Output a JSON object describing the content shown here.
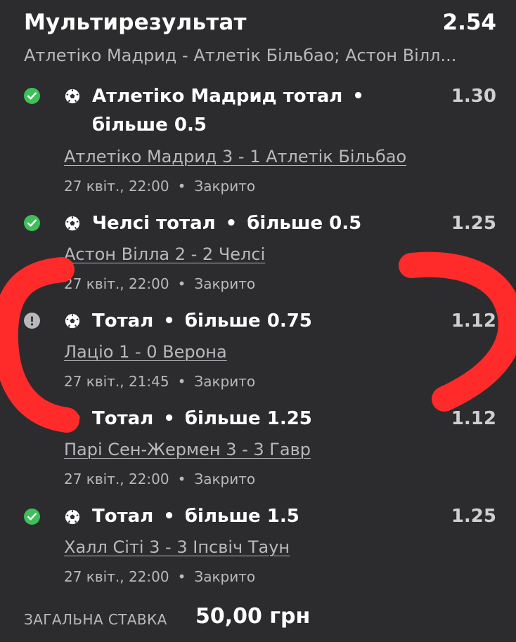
{
  "header": {
    "title": "Мультирезультат",
    "total_odds": "2.54",
    "events_summary": "Атлетіко Мадрид - Атлетік Більбао; Астон Вілл..."
  },
  "selections": [
    {
      "status": "won",
      "market_line1": "Атлетіко Мадрид тотал",
      "market_line2": "більше 0.5",
      "odds": "1.30",
      "match": "Атлетіко Мадрид 3 - 1 Атлетік Більбао",
      "date": "27 квіт., 22:00",
      "state": "Закрито"
    },
    {
      "status": "won",
      "market_line1": "Челсі тотал",
      "market_line2": "більше 0.5",
      "odds": "1.25",
      "match": "Астон Вілла 2 - 2 Челсі",
      "date": "27 квіт., 22:00",
      "state": "Закрито"
    },
    {
      "status": "alert",
      "market_line1": "Тотал",
      "market_line2": "більше 0.75",
      "odds": "1.12",
      "match": "Лаціо 1 - 0 Верона",
      "date": "27 квіт., 21:45",
      "state": "Закрито"
    },
    {
      "status": "hidden",
      "market_line1": "Тотал",
      "market_line2": "більше 1.25",
      "odds": "1.12",
      "match": "Парі Сен-Жермен 3 - 3 Гавр",
      "date": "27 квіт., 22:00",
      "state": "Закрито"
    },
    {
      "status": "won",
      "market_line1": "Тотал",
      "market_line2": "більше 1.5",
      "odds": "1.25",
      "match": "Халл Сіті 3 - 3 Іпсвіч Таун",
      "date": "27 квіт., 22:00",
      "state": "Закрито"
    }
  ],
  "footer": {
    "stake_label": "ЗАГАЛЬНА СТАВКА",
    "stake_value": "50,00 грн"
  },
  "colors": {
    "background": "#2c2c2e",
    "won": "#3fbf5a",
    "alert": "#b9b9bd",
    "annotation": "#ff2a2a"
  },
  "icons": {
    "won": "check-circle-icon",
    "alert": "exclamation-circle-icon",
    "sport": "soccer-ball-icon"
  }
}
